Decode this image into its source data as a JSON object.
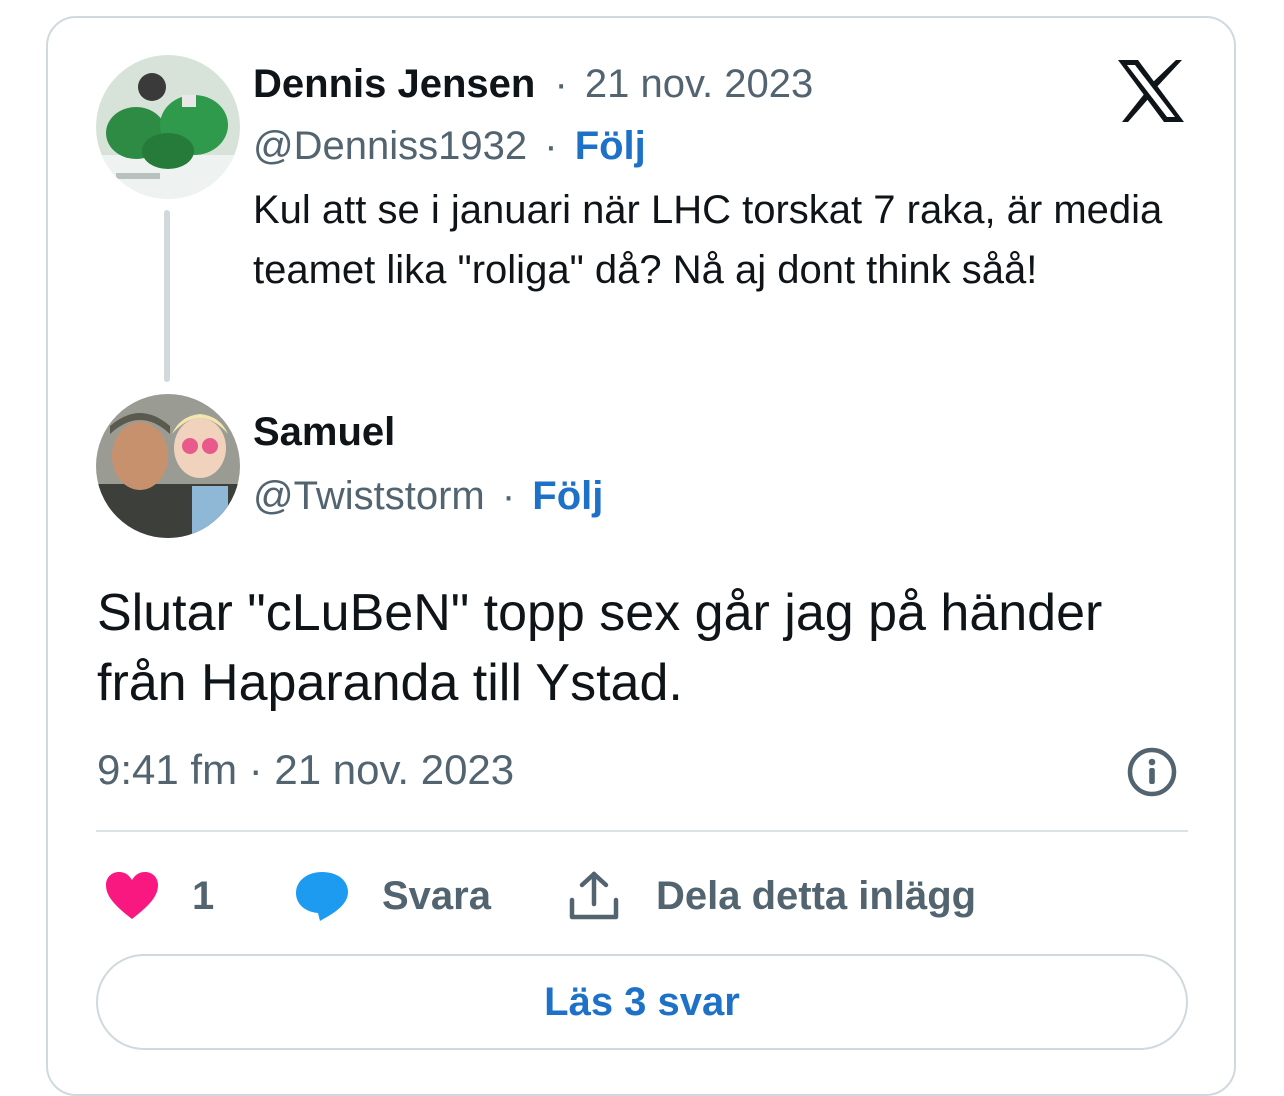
{
  "quoted_post": {
    "author_name": "Dennis Jensen",
    "separator": "·",
    "date": "21 nov. 2023",
    "handle": "@Denniss1932",
    "follow_label": "Följ",
    "text": "Kul att se i januari när LHC torskat 7 raka, är media teamet lika \"roliga\" då? Nå aj dont think såå!",
    "avatar_icon": "hockey-player-avatar"
  },
  "main_post": {
    "author_name": "Samuel",
    "handle": "@Twiststorm",
    "separator": "·",
    "follow_label": "Följ",
    "text": "Slutar \"cLuBeN\" topp sex går jag på händer från Haparanda till Ystad.",
    "timestamp": "9:41 fm · 21 nov. 2023",
    "avatar_icon": "selfie-avatar"
  },
  "actions": {
    "like_count": "1",
    "reply_label": "Svara",
    "share_label": "Dela detta inlägg"
  },
  "read_replies_label": "Läs 3 svar",
  "icons": {
    "brand": "x-logo-icon",
    "info": "info-icon",
    "like": "heart-icon",
    "reply": "speech-bubble-icon",
    "share": "share-upload-icon"
  },
  "colors": {
    "link_blue": "#1d72c8",
    "like_pink": "#f91880",
    "reply_blue": "#1d9bf0",
    "muted_text": "#536471",
    "border": "#cfd9de"
  }
}
